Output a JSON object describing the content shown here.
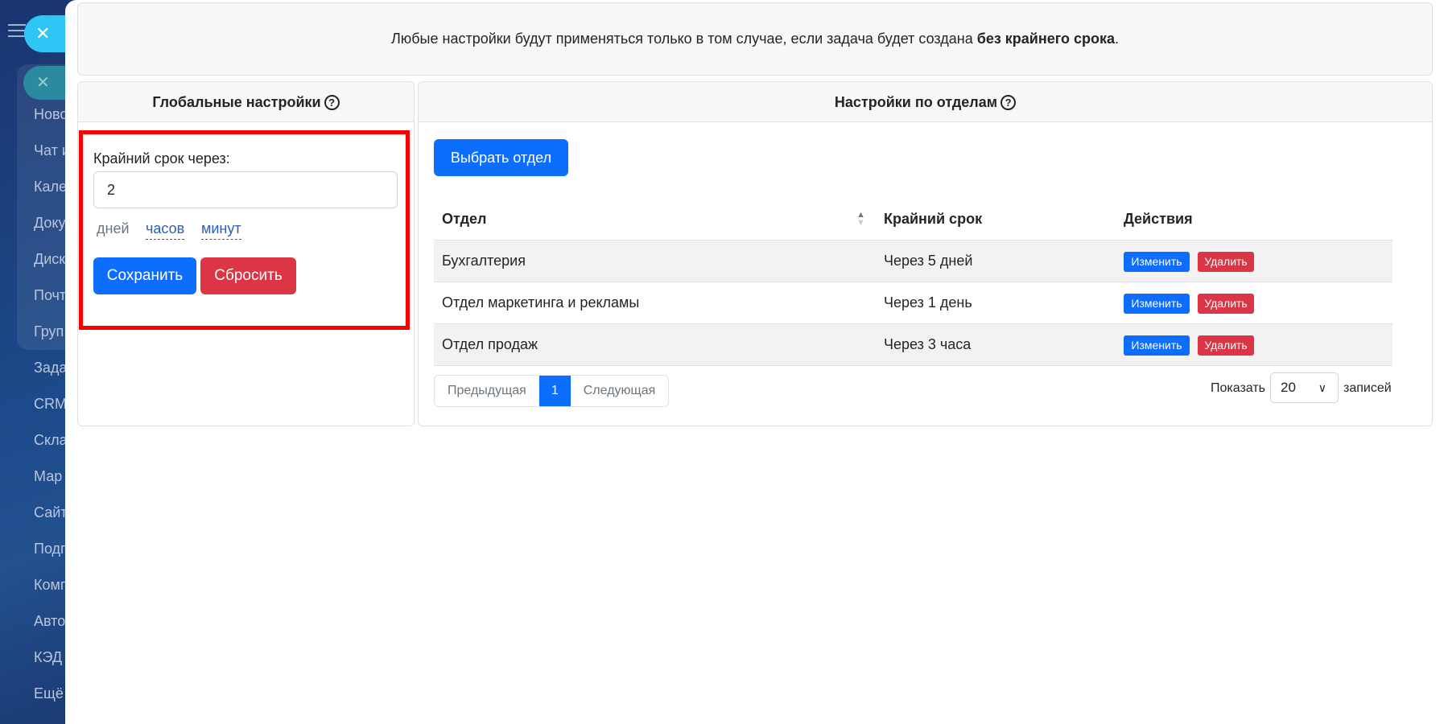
{
  "sidebar": {
    "items": [
      "Ново",
      "Чат и",
      "Кале",
      "Доку",
      "Диск",
      "Почт",
      "Груп",
      "Зада",
      "CRM",
      "Скла",
      "Мар",
      "Сайт",
      "Подп",
      "Комп",
      "Авто",
      "КЭД",
      "Ещё"
    ],
    "close": "✕"
  },
  "notice": {
    "text": "Любые настройки будут применяться только в том случае, если задача будет создана ",
    "bold": "без крайнего срока",
    "end": "."
  },
  "global": {
    "title": "Глобальные настройки",
    "help": "?",
    "label": "Крайний срок через:",
    "value": "2",
    "units": [
      "дней",
      "часов",
      "минут"
    ],
    "save": "Сохранить",
    "reset": "Сбросить"
  },
  "dept": {
    "title": "Настройки по отделам",
    "help": "?",
    "select_button": "Выбрать отдел",
    "columns": [
      "Отдел",
      "Крайний срок",
      "Действия"
    ],
    "rows": [
      {
        "name": "Бухгалтерия",
        "deadline": "Через 5 дней"
      },
      {
        "name": "Отдел маркетинга и рекламы",
        "deadline": "Через 1 день"
      },
      {
        "name": "Отдел продаж",
        "deadline": "Через 3 часа"
      }
    ],
    "edit": "Изменить",
    "delete": "Удалить",
    "pager": {
      "prev": "Предыдущая",
      "current": "1",
      "next": "Следующая"
    },
    "show": "Показать",
    "page_size": "20",
    "records": "записей"
  },
  "colors": {
    "accent": "#0d6efd",
    "danger": "#dc3545",
    "highlight": "#ff0000"
  }
}
